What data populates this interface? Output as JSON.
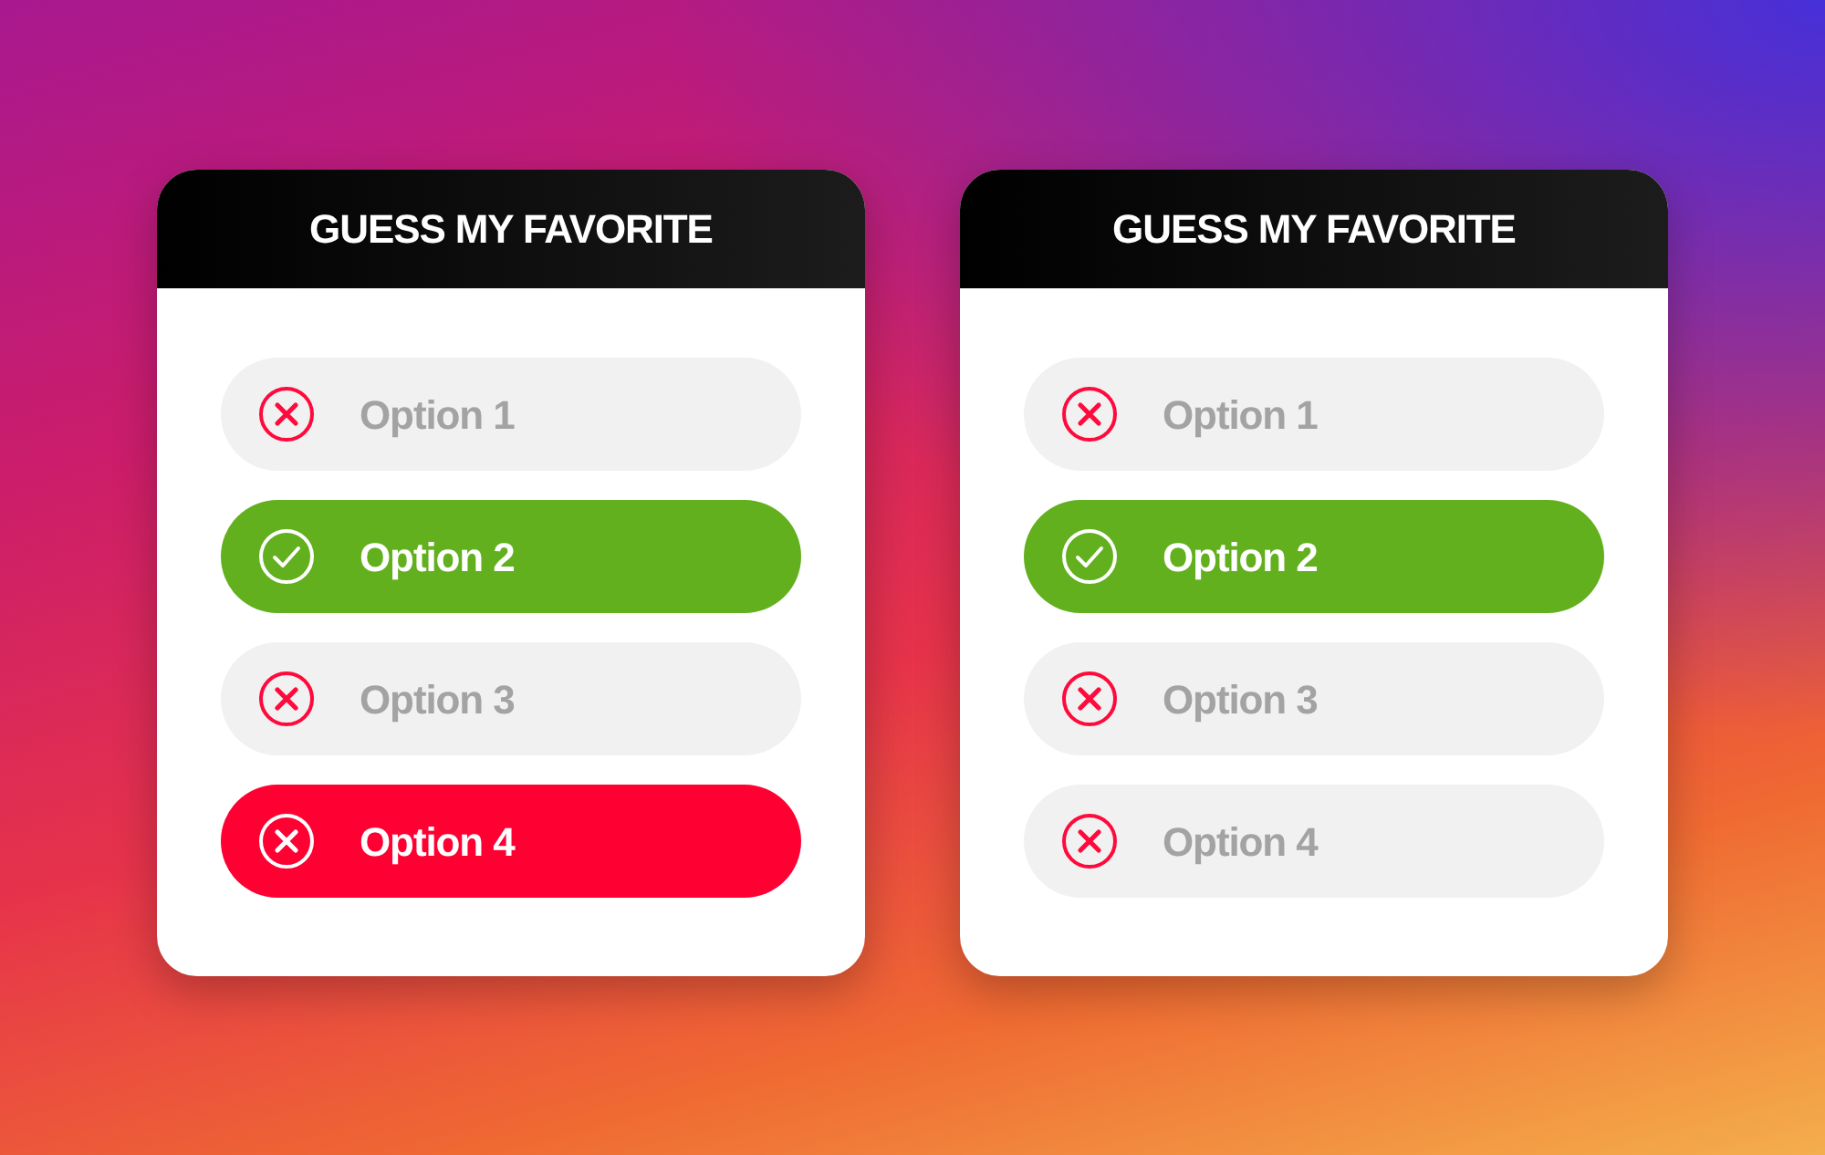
{
  "cards": [
    {
      "title": "GUESS MY FAVORITE",
      "options": [
        {
          "label": "Option 1",
          "selected": false,
          "correct": false
        },
        {
          "label": "Option 2",
          "selected": true,
          "correct": true
        },
        {
          "label": "Option 3",
          "selected": false,
          "correct": false
        },
        {
          "label": "Option 4",
          "selected": true,
          "correct": false
        }
      ]
    },
    {
      "title": "GUESS MY FAVORITE",
      "options": [
        {
          "label": "Option 1",
          "selected": false,
          "correct": false
        },
        {
          "label": "Option 2",
          "selected": true,
          "correct": true
        },
        {
          "label": "Option 3",
          "selected": false,
          "correct": false
        },
        {
          "label": "Option 4",
          "selected": false,
          "correct": false
        }
      ]
    }
  ]
}
